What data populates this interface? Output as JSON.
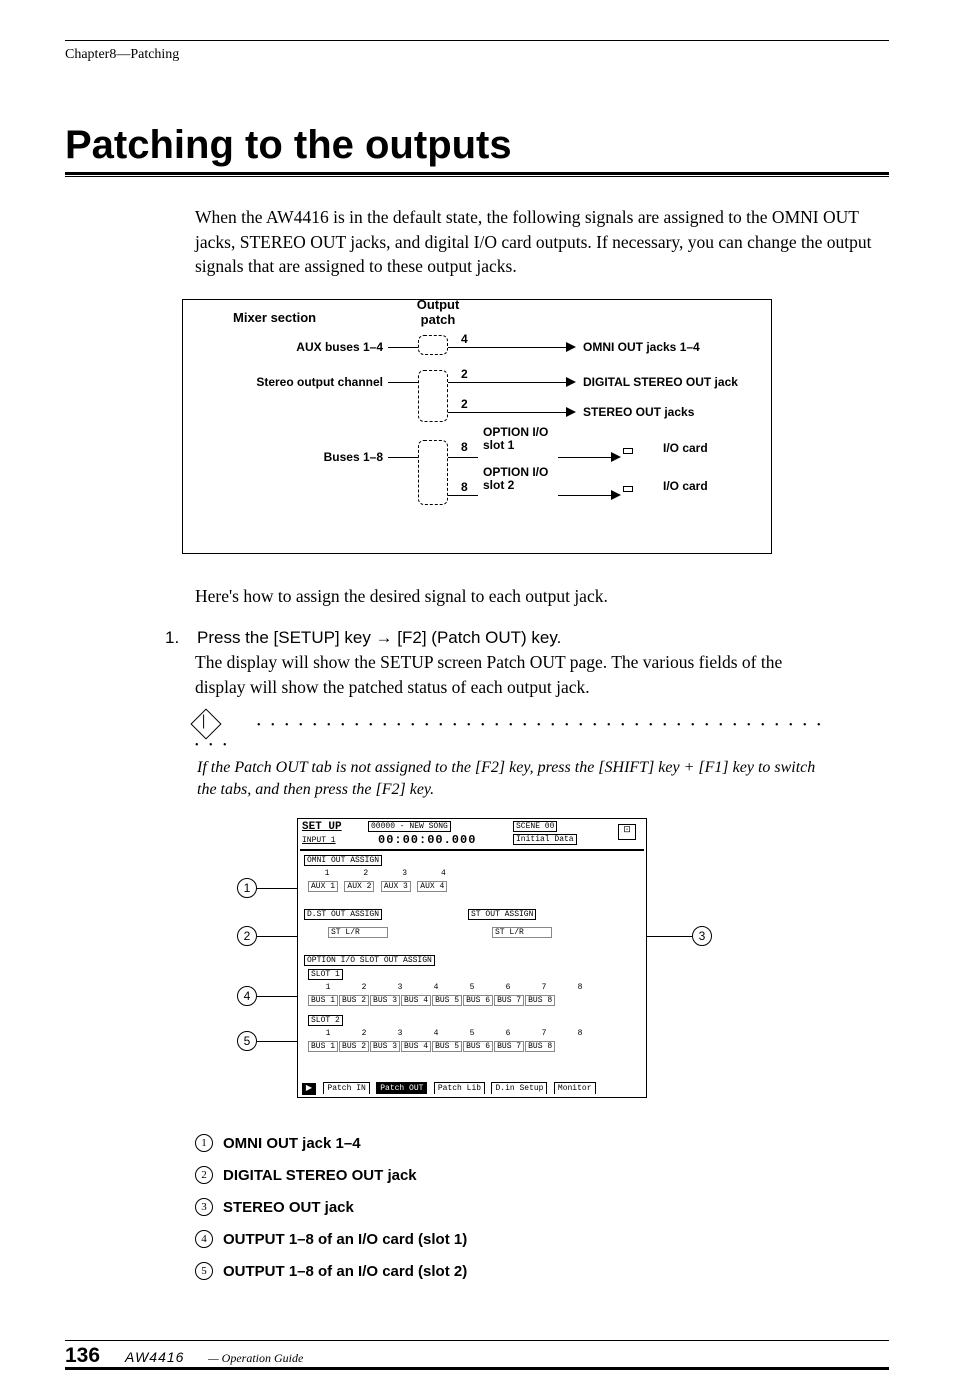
{
  "chapter": "Chapter8—Patching",
  "title": "Patching to the outputs",
  "intro": "When the AW4416 is in the default state, the following signals are assigned to the OMNI OUT jacks, STEREO OUT jacks, and digital I/O card outputs. If necessary, you can change the output signals that are assigned to these output jacks.",
  "diagram": {
    "mixer_section": "Mixer section",
    "output_patch": "Output patch",
    "rows": {
      "aux": {
        "left": "AUX buses 1–4",
        "count": "4",
        "right": "OMNI OUT jacks 1–4"
      },
      "stereo1": {
        "left": "Stereo output channel",
        "count": "2",
        "right": "DIGITAL STEREO OUT jack"
      },
      "stereo2": {
        "count": "2",
        "right": "STEREO OUT jacks"
      },
      "bus1": {
        "left": "Buses 1–8",
        "count": "8",
        "mid": "OPTION I/O slot 1",
        "right": "I/O card"
      },
      "bus2": {
        "count": "8",
        "mid": "OPTION I/O slot 2",
        "right": "I/O card"
      }
    }
  },
  "para2": "Here's how to assign the desired signal to each output jack.",
  "step1": {
    "num": "1.",
    "head": "Press the [SETUP] key → [F2] (Patch OUT) key.",
    "body": "The display will show the SETUP screen Patch OUT page. The various fields of the display will show the patched status of each output jack."
  },
  "note": "If the Patch OUT tab is not assigned to the [F2] key, press the [SHIFT] key + [F1] key to switch the tabs, and then press the [F2] key.",
  "screen": {
    "title_left": "SET UP",
    "title_sub": "INPUT 1",
    "song": "00000 - NEW SONG",
    "time": "00:00:00.000",
    "scene": "SCENE 00",
    "data": "Initial Data",
    "sec1": {
      "label": "OMNI OUT ASSIGN",
      "cols": [
        "1",
        "2",
        "3",
        "4"
      ],
      "vals": [
        "AUX 1",
        "AUX 2",
        "AUX 3",
        "AUX 4"
      ]
    },
    "sec2a": {
      "label": "D.ST OUT ASSIGN",
      "val": "ST    L/R"
    },
    "sec2b": {
      "label": "ST OUT ASSIGN",
      "val": "ST    L/R"
    },
    "sec3": {
      "label": "OPTION I/O SLOT OUT ASSIGN"
    },
    "slot1": {
      "label": "SLOT 1",
      "cols": [
        "1",
        "2",
        "3",
        "4",
        "5",
        "6",
        "7",
        "8"
      ],
      "vals": [
        "BUS 1",
        "BUS 2",
        "BUS 3",
        "BUS 4",
        "BUS 5",
        "BUS 6",
        "BUS 7",
        "BUS 8"
      ]
    },
    "slot2": {
      "label": "SLOT 2",
      "cols": [
        "1",
        "2",
        "3",
        "4",
        "5",
        "6",
        "7",
        "8"
      ],
      "vals": [
        "BUS 1",
        "BUS 2",
        "BUS 3",
        "BUS 4",
        "BUS 5",
        "BUS 6",
        "BUS 7",
        "BUS 8"
      ]
    },
    "tabs": [
      "Patch IN",
      "Patch OUT",
      "Patch Lib",
      "D.in Setup",
      "Monitor"
    ]
  },
  "legend": {
    "l1": "OMNI OUT jack 1–4",
    "l2": "DIGITAL STEREO OUT jack",
    "l3": "STEREO OUT jack",
    "l4": "OUTPUT 1–8 of an I/O card (slot 1)",
    "l5": "OUTPUT 1–8 of an I/O card (slot 2)"
  },
  "footer": {
    "page": "136",
    "product": "AW4416",
    "guide": "— Operation Guide"
  }
}
